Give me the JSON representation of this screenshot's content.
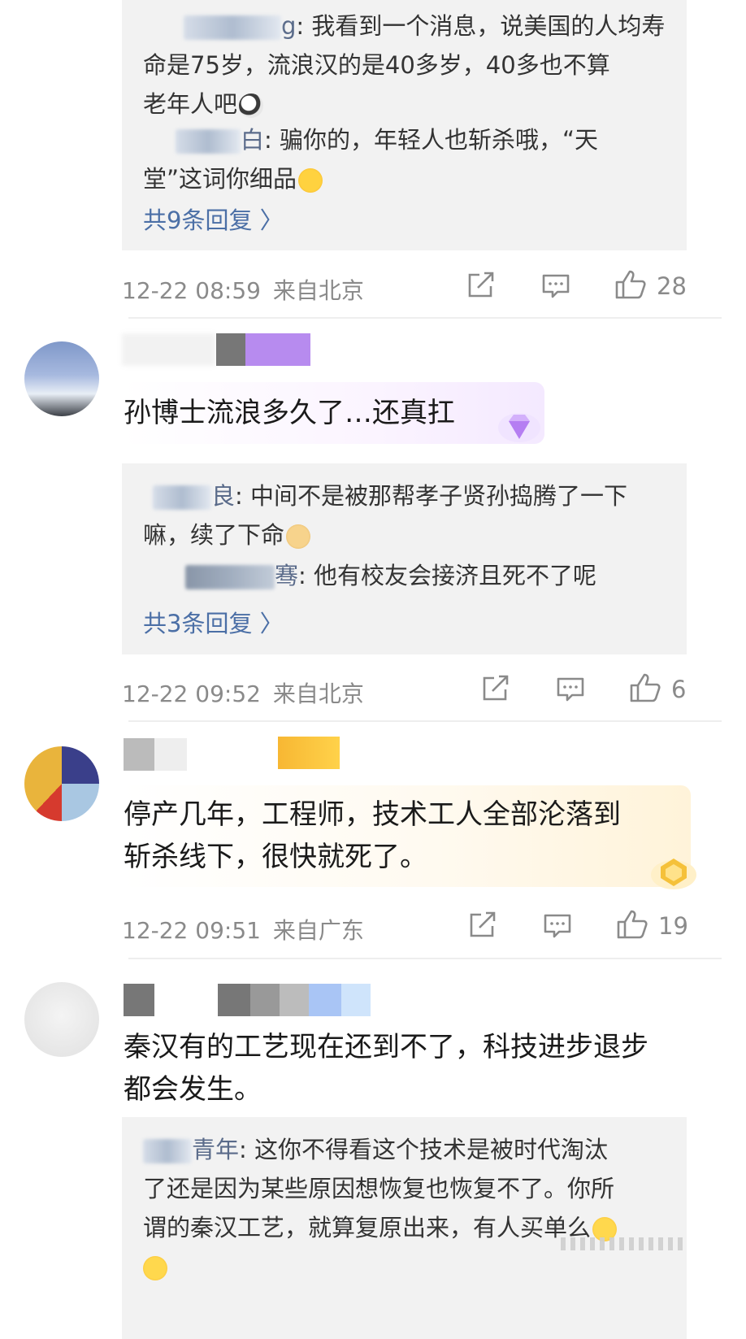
{
  "comments": [
    {
      "replies": [
        {
          "name_tail": "g",
          "text_lines": [
            "我看到一个消息，说美国的人均寿",
            "命是75岁，流浪汉的是40多岁，40多也不算",
            "老年人吧"
          ]
        },
        {
          "name_tail": "白",
          "text_lines": [
            "骗你的，年轻人也斩杀哦，“天",
            "堂”这词你细品"
          ]
        }
      ],
      "more_replies": "共9条回复 〉",
      "time": "12-22 08:59",
      "location": "来自北京",
      "likes": "28"
    },
    {
      "text": "孙博士流浪多久了…还真扛",
      "replies": [
        {
          "name_tail": "良",
          "text_lines": [
            "中间不是被那帮孝子贤孙捣腾了一下",
            "嘛，续了下命"
          ]
        },
        {
          "name_tail": "骞",
          "text_lines": [
            "他有校友会接济且死不了呢"
          ]
        }
      ],
      "more_replies": "共3条回复 〉",
      "time": "12-22 09:52",
      "location": "来自北京",
      "likes": "6"
    },
    {
      "text_lines": [
        "停产几年，工程师，技术工人全部沦落到",
        "斩杀线下，很快就死了。"
      ],
      "time": "12-22 09:51",
      "location": "来自广东",
      "likes": "19"
    },
    {
      "text_lines": [
        "秦汉有的工艺现在还到不了，科技进步退步",
        "都会发生。"
      ],
      "replies": [
        {
          "name_tail": "青年",
          "text_lines": [
            "这你不得看这个技术是被时代淘汰",
            "了还是因为某些原因想恢复也恢复不了。你所",
            "谓的秦汉工艺，就算复原出来，有人买单么"
          ]
        }
      ]
    }
  ],
  "icons": {
    "share": "share-icon",
    "comment": "comment-icon",
    "like": "thumbs-up-icon"
  },
  "colors": {
    "link": "#4b6fa6",
    "meta": "#8a8a8a",
    "reply_bg": "#f2f2f2"
  }
}
